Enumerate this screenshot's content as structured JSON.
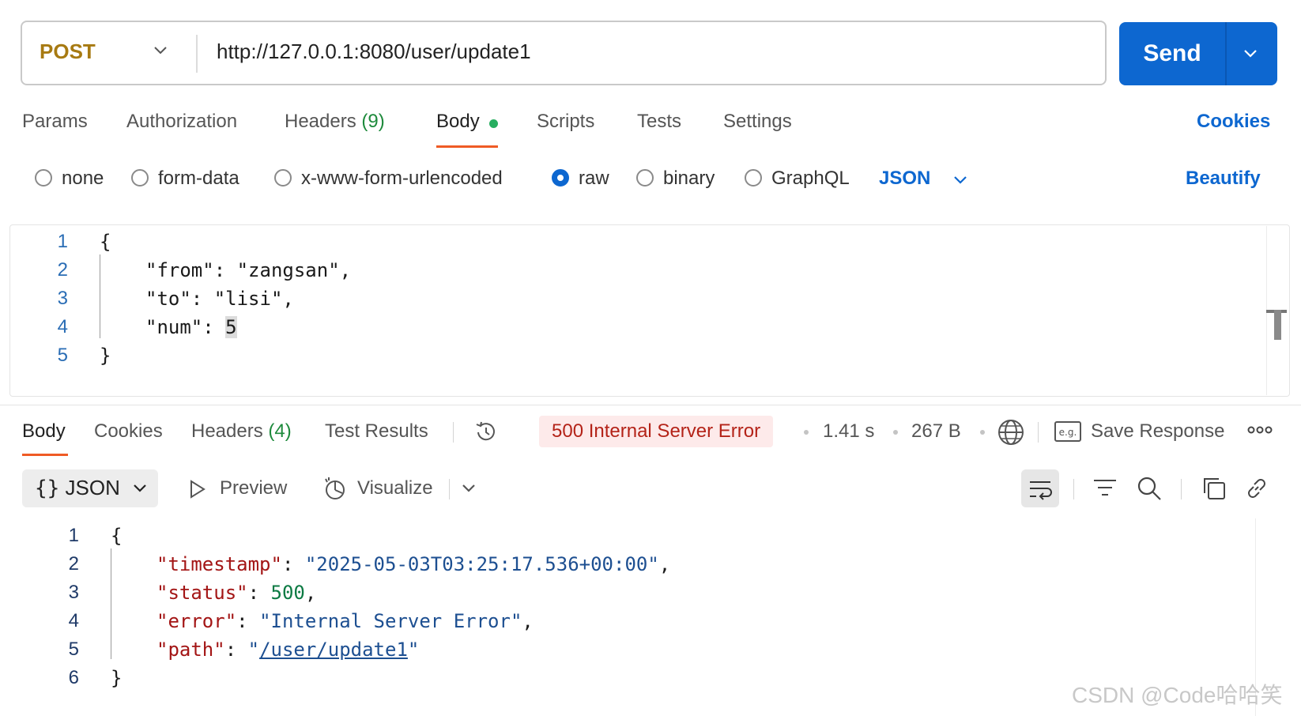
{
  "request": {
    "method": "POST",
    "url": "http://127.0.0.1:8080/user/update1",
    "send_label": "Send"
  },
  "request_tabs": {
    "params": "Params",
    "authorization": "Authorization",
    "headers": "Headers",
    "headers_count": "(9)",
    "body": "Body",
    "scripts": "Scripts",
    "tests": "Tests",
    "settings": "Settings",
    "cookies": "Cookies"
  },
  "body_types": {
    "options": [
      "none",
      "form-data",
      "x-www-form-urlencoded",
      "raw",
      "binary",
      "GraphQL"
    ],
    "selected": "raw",
    "format": "JSON",
    "beautify": "Beautify"
  },
  "request_body": {
    "line_numbers": [
      "1",
      "2",
      "3",
      "4",
      "5"
    ],
    "open_brace": "{",
    "line2": "\"from\": \"zangsan\",",
    "line3": "\"to\": \"lisi\",",
    "line4_key": "\"num\": ",
    "line4_value": "5",
    "close_brace": "}"
  },
  "response_tabs": {
    "body": "Body",
    "cookies": "Cookies",
    "headers": "Headers",
    "headers_count": "(4)",
    "test_results": "Test Results"
  },
  "response_meta": {
    "status": "500 Internal Server Error",
    "time": "1.41 s",
    "size": "267 B",
    "save_response": "Save Response"
  },
  "response_toolbar": {
    "format": "JSON",
    "preview": "Preview",
    "visualize": "Visualize"
  },
  "response_body": {
    "line_numbers": [
      "1",
      "2",
      "3",
      "4",
      "5",
      "6"
    ],
    "open_brace": "{",
    "timestamp_key": "\"timestamp\"",
    "timestamp_value": "\"2025-05-03T03:25:17.536+00:00\"",
    "status_key": "\"status\"",
    "status_value": "500",
    "error_key": "\"error\"",
    "error_value": "\"Internal Server Error\"",
    "path_key": "\"path\"",
    "path_value": "/user/update1",
    "close_brace": "}"
  },
  "watermark": "CSDN @Code哈哈笑",
  "colors": {
    "accent": "#0d67d0",
    "method": "#a77a12",
    "tab_underline": "#ef5b25",
    "error_badge_bg": "#fdeaea",
    "error_badge_text": "#b42318"
  }
}
